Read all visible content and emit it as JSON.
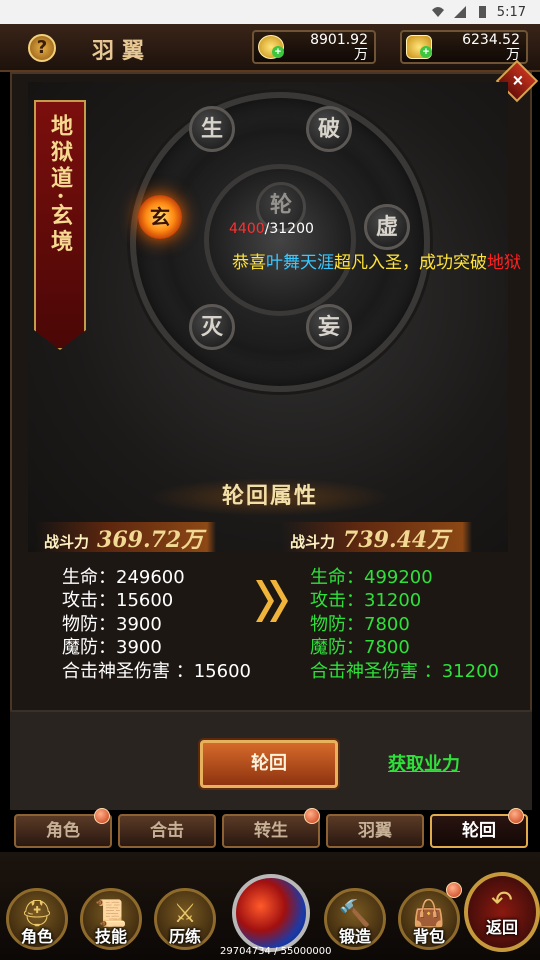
{
  "status_bar": {
    "time": "5:17"
  },
  "header": {
    "help_label": "?",
    "title": "羽翼",
    "gold": {
      "value": "8901.92",
      "unit": "万"
    },
    "ingot": {
      "value": "6234.52",
      "unit": "万"
    }
  },
  "close_label": "×",
  "realm": {
    "banner": "地狱道·玄境",
    "fire_orb": "玄",
    "progress_current": "4400",
    "progress_max": "/31200",
    "orbs": [
      "生",
      "破",
      "虚",
      "妄",
      "灭",
      "轮"
    ]
  },
  "broadcast": {
    "prefix": "恭喜",
    "player": "叶舞天涯",
    "mid": "超凡入圣，成功突破",
    "tail": "地狱"
  },
  "attributes": {
    "title": "轮回属性",
    "power_label": "战斗力",
    "current_power": "369.72万",
    "next_power": "739.44万",
    "current": [
      "生命：249600",
      "攻击：15600",
      "物防：3900",
      "魔防：3900",
      "合击神圣伤害 ：15600"
    ],
    "next": [
      "生命：499200",
      "攻击：31200",
      "物防：7800",
      "魔防：7800",
      "合击神圣伤害 ：31200"
    ]
  },
  "actions": {
    "cycle": "轮回",
    "karma": "获取业力"
  },
  "subtabs": [
    "角色",
    "合击",
    "转生",
    "羽翼",
    "轮回"
  ],
  "nav": [
    "角色",
    "技能",
    "历练",
    "锻造",
    "背包",
    "返回"
  ],
  "exp": "29704734 / 55000000",
  "colors": {
    "accent_gold": "#e7c895",
    "upgrade_green": "#2fe03a",
    "warn_red": "#ff3030",
    "link_blue": "#3ac8ff"
  }
}
